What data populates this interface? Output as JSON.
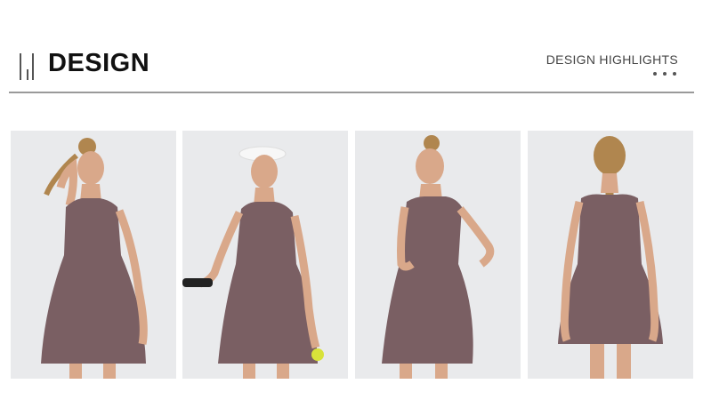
{
  "header": {
    "title": "DESIGN",
    "highlights_label": "DESIGN HIGHLIGHTS"
  },
  "photos": [
    {
      "name": "front-view"
    },
    {
      "name": "side-view-racket"
    },
    {
      "name": "three-quarter-view-pocket"
    },
    {
      "name": "back-view"
    }
  ],
  "colors": {
    "background": "#ffffff",
    "photo_backdrop": "#e9eaec",
    "dress": "#7a5f63",
    "skin": "#d9a88a",
    "hair": "#b0864f"
  }
}
